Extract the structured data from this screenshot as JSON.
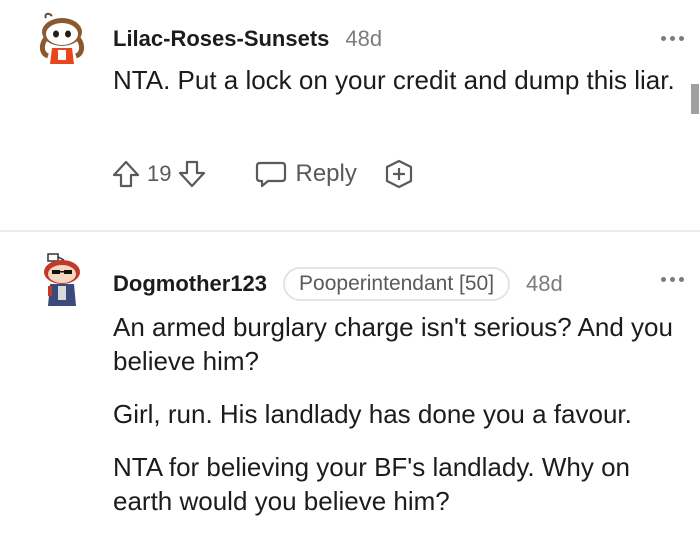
{
  "comments": [
    {
      "username": "Lilac-Roses-Sunsets",
      "time": "48d",
      "paragraphs": [
        "NTA. Put a lock on your credit and dump this liar."
      ],
      "votes": "19",
      "reply_label": "Reply"
    },
    {
      "username": "Dogmother123",
      "flair": "Pooperintendant [50]",
      "time": "48d",
      "paragraphs": [
        "An armed burglary charge isn't serious? And you believe him?",
        "Girl, run. His landlady has done you a favour.",
        "NTA for believing your BF's landlady. Why on earth would you believe him?"
      ]
    }
  ],
  "icons": {
    "upvote": "upvote-arrow-icon",
    "downvote": "downvote-arrow-icon",
    "reply": "speech-bubble-icon",
    "award": "award-plus-icon",
    "more": "more-options-dots-icon"
  },
  "colors": {
    "text": "#1c1c1c",
    "meta": "#7c7c7c",
    "icon": "#5a5a5a",
    "divider": "#ececec",
    "avatar_orange": "#e8461e"
  }
}
